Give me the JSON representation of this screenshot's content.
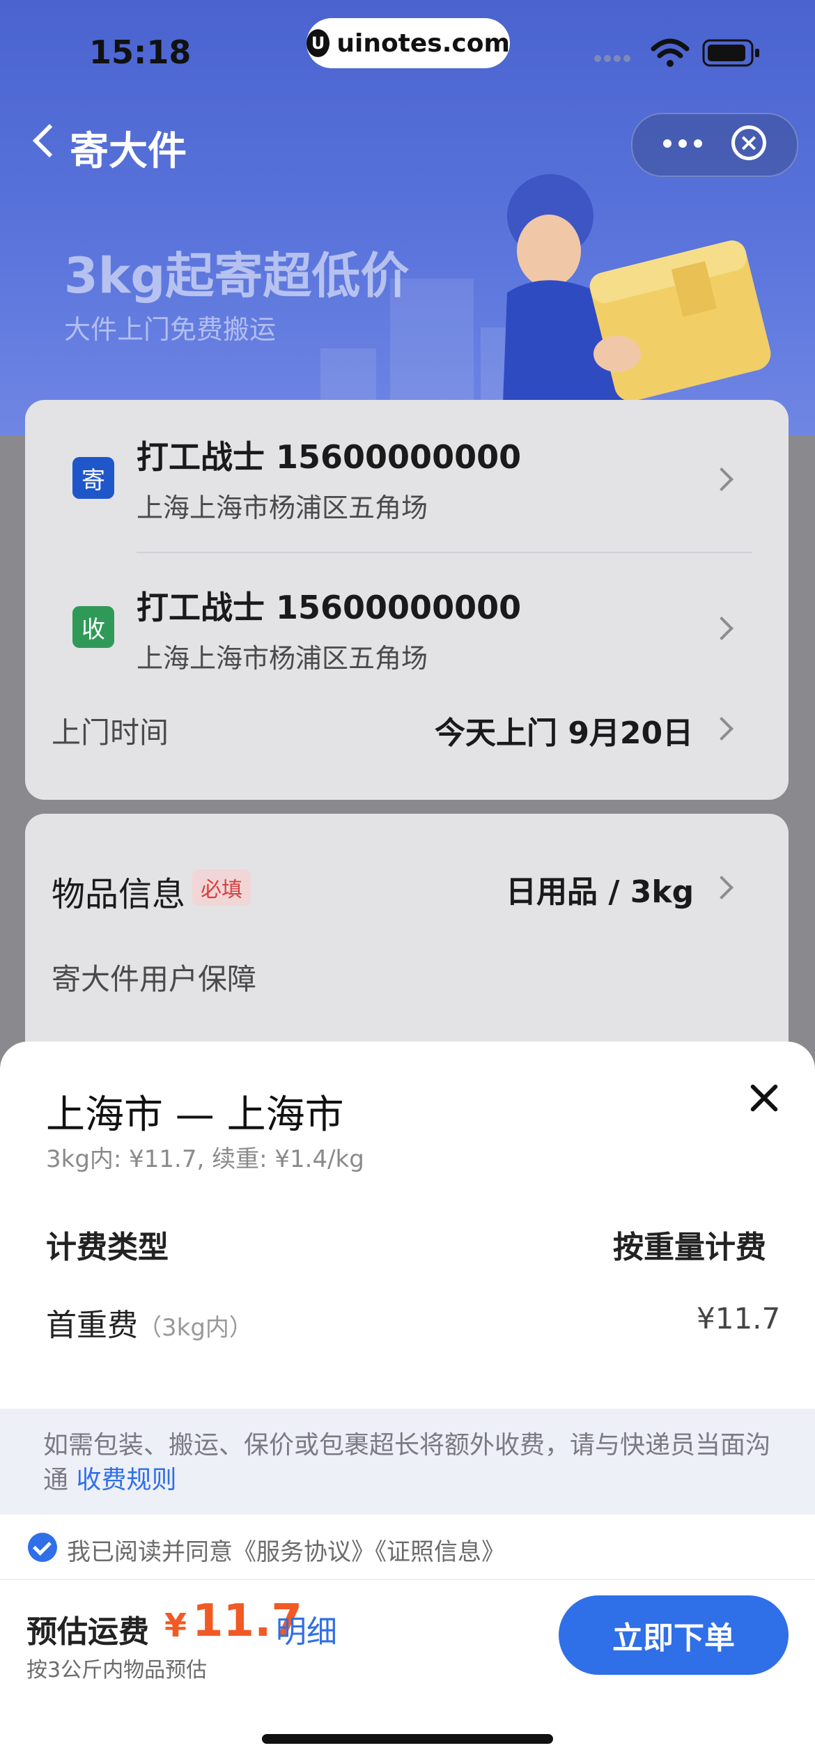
{
  "status_bar": {
    "time": "15:18",
    "url": "uinotes.com"
  },
  "nav": {
    "title": "寄大件"
  },
  "banner": {
    "headline": "3kg起寄超低价",
    "subline": "大件上门免费搬运"
  },
  "sender": {
    "tag": "寄",
    "name": "打工战士 15600000000",
    "address": "上海上海市杨浦区五角场"
  },
  "receiver": {
    "tag": "收",
    "name": "打工战士 15600000000",
    "address": "上海上海市杨浦区五角场"
  },
  "pickup": {
    "label": "上门时间",
    "value": "今天上门 9月20日"
  },
  "item_info": {
    "label": "物品信息",
    "required_tag": "必填",
    "value": "日用品 / 3kg"
  },
  "guarantee": {
    "label": "寄大件用户保障"
  },
  "sheet": {
    "title": "上海市 — 上海市",
    "subtitle": "3kg内: ¥11.7, 续重: ¥1.4/kg",
    "billing_label": "计费类型",
    "billing_value": "按重量计费",
    "fee_label": "首重费",
    "fee_note": "（3kg内）",
    "fee_value": "¥11.7",
    "notice_text": "如需包装、搬运、保价或包裹超长将额外收费，请与快递员当面沟通",
    "notice_link": "收费规则",
    "agreement_text": "我已阅读并同意《服务协议》《证照信息》"
  },
  "footer": {
    "est_label": "预估运费",
    "currency": "¥",
    "price": "11.7",
    "detail_link": "明细",
    "note": "按3公斤内物品预估",
    "submit_label": "立即下单"
  },
  "colors": {
    "accent": "#2f6fe8",
    "price": "#f15a24",
    "send_tag": "#1f56c9",
    "receive_tag": "#2f9a58"
  }
}
